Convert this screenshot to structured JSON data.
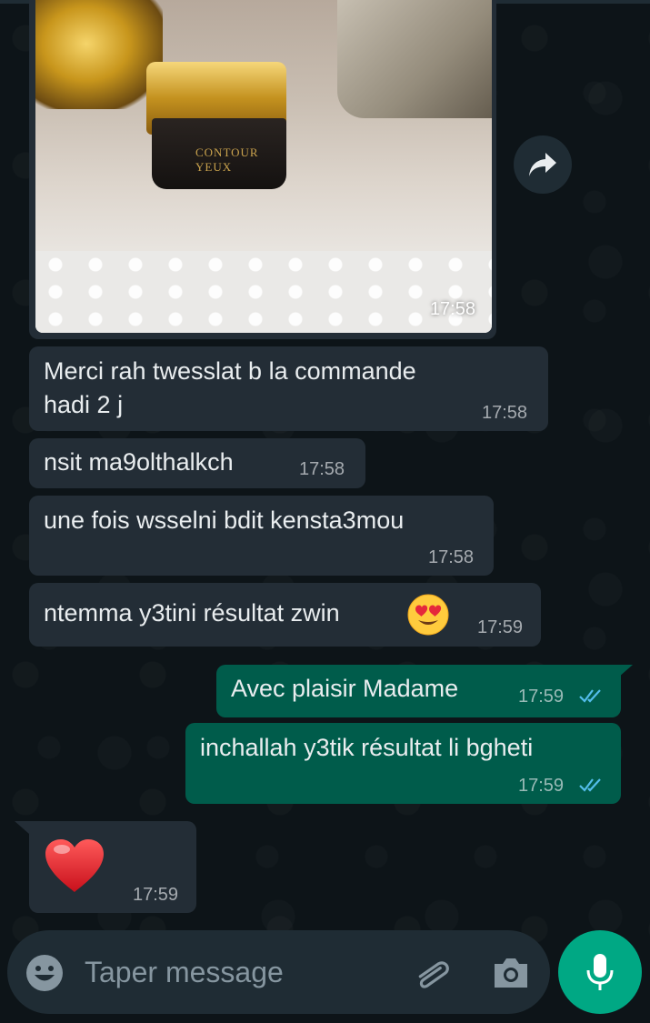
{
  "conversation": {
    "image_message": {
      "jar_label": "CONTOUR\nYEUX",
      "time": "17:58"
    },
    "messages": [
      {
        "direction": "in",
        "lines": [
          "Merci rah twesslat b la commande",
          "hadi 2 j"
        ],
        "time": "17:58"
      },
      {
        "direction": "in",
        "text": "nsit ma9olthalkch",
        "time": "17:58"
      },
      {
        "direction": "in",
        "text": "une fois wsselni bdit kensta3mou",
        "time": "17:58"
      },
      {
        "direction": "in",
        "text": "ntemma y3tini résultat zwin",
        "emoji": "smiling-face-with-heart-eyes",
        "time": "17:59"
      },
      {
        "direction": "out",
        "text": "Avec plaisir Madame",
        "time": "17:59",
        "status": "read"
      },
      {
        "direction": "out",
        "text": "inchallah y3tik résultat li bgheti",
        "time": "17:59",
        "status": "read"
      },
      {
        "direction": "in",
        "emoji": "red-heart",
        "time": "17:59"
      }
    ]
  },
  "composer": {
    "placeholder": "Taper message"
  },
  "icons": {
    "forward": "forward-arrow-icon",
    "emoji": "emoji-smiley-icon",
    "attach": "paperclip-icon",
    "camera": "camera-icon",
    "mic": "microphone-icon",
    "read_receipt": "double-check-icon"
  },
  "colors": {
    "incoming_bubble": "#232d36",
    "outgoing_bubble": "#005c4b",
    "accent": "#00a884",
    "read_tick": "#53bdeb"
  }
}
